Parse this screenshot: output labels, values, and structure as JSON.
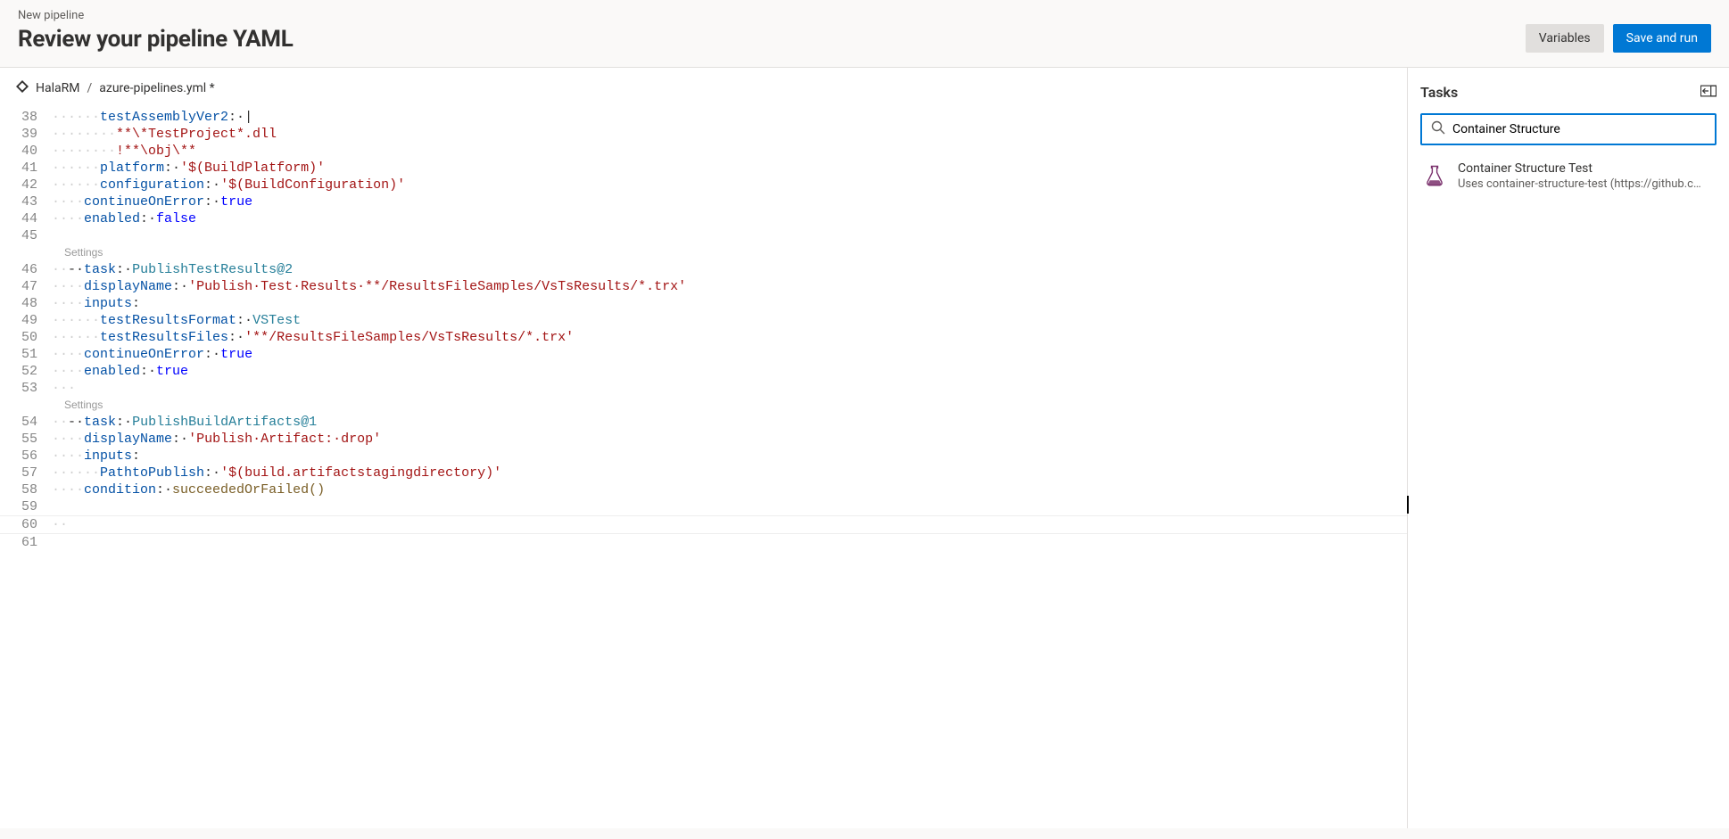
{
  "header": {
    "breadcrumb": "New pipeline",
    "title": "Review your pipeline YAML",
    "variables_label": "Variables",
    "save_run_label": "Save and run"
  },
  "file_bar": {
    "repo": "HalaRM",
    "sep": "/",
    "file": "azure-pipelines.yml *"
  },
  "codelens": {
    "settings": "Settings"
  },
  "code_lines": [
    {
      "n": 38,
      "tokens": [
        {
          "t": "ws",
          "v": "······"
        },
        {
          "t": "key",
          "v": "testAssemblyVer2"
        },
        {
          "t": "plain",
          "v": ":·"
        },
        {
          "t": "plain",
          "v": "|"
        }
      ]
    },
    {
      "n": 39,
      "tokens": [
        {
          "t": "ws",
          "v": "········"
        },
        {
          "t": "str",
          "v": "**\\*TestProject*.dll"
        }
      ]
    },
    {
      "n": 40,
      "tokens": [
        {
          "t": "ws",
          "v": "········"
        },
        {
          "t": "str",
          "v": "!**\\obj\\**"
        }
      ]
    },
    {
      "n": 41,
      "tokens": [
        {
          "t": "ws",
          "v": "······"
        },
        {
          "t": "key",
          "v": "platform"
        },
        {
          "t": "plain",
          "v": ":·"
        },
        {
          "t": "str",
          "v": "'$(BuildPlatform)'"
        }
      ]
    },
    {
      "n": 42,
      "tokens": [
        {
          "t": "ws",
          "v": "······"
        },
        {
          "t": "key",
          "v": "configuration"
        },
        {
          "t": "plain",
          "v": ":·"
        },
        {
          "t": "str",
          "v": "'$(BuildConfiguration)'"
        }
      ]
    },
    {
      "n": 43,
      "tokens": [
        {
          "t": "ws",
          "v": "····"
        },
        {
          "t": "key",
          "v": "continueOnError"
        },
        {
          "t": "plain",
          "v": ":·"
        },
        {
          "t": "bool",
          "v": "true"
        }
      ]
    },
    {
      "n": 44,
      "tokens": [
        {
          "t": "ws",
          "v": "····"
        },
        {
          "t": "key",
          "v": "enabled"
        },
        {
          "t": "plain",
          "v": ":·"
        },
        {
          "t": "bool",
          "v": "false"
        }
      ]
    },
    {
      "n": 45,
      "tokens": []
    },
    {
      "codelens": "settings"
    },
    {
      "n": 46,
      "tokens": [
        {
          "t": "ws",
          "v": "··"
        },
        {
          "t": "plain",
          "v": "-·"
        },
        {
          "t": "key",
          "v": "task"
        },
        {
          "t": "plain",
          "v": ":·"
        },
        {
          "t": "type",
          "v": "PublishTestResults@2"
        }
      ]
    },
    {
      "n": 47,
      "tokens": [
        {
          "t": "ws",
          "v": "····"
        },
        {
          "t": "key",
          "v": "displayName"
        },
        {
          "t": "plain",
          "v": ":·"
        },
        {
          "t": "str",
          "v": "'Publish·Test·Results·**/ResultsFileSamples/VsTsResults/*.trx'"
        }
      ]
    },
    {
      "n": 48,
      "tokens": [
        {
          "t": "ws",
          "v": "····"
        },
        {
          "t": "key",
          "v": "inputs"
        },
        {
          "t": "plain",
          "v": ":"
        }
      ]
    },
    {
      "n": 49,
      "tokens": [
        {
          "t": "ws",
          "v": "······"
        },
        {
          "t": "key",
          "v": "testResultsFormat"
        },
        {
          "t": "plain",
          "v": ":·"
        },
        {
          "t": "type",
          "v": "VSTest"
        }
      ]
    },
    {
      "n": 50,
      "tokens": [
        {
          "t": "ws",
          "v": "······"
        },
        {
          "t": "key",
          "v": "testResultsFiles"
        },
        {
          "t": "plain",
          "v": ":·"
        },
        {
          "t": "str",
          "v": "'**/ResultsFileSamples/VsTsResults/*.trx'"
        }
      ]
    },
    {
      "n": 51,
      "tokens": [
        {
          "t": "ws",
          "v": "····"
        },
        {
          "t": "key",
          "v": "continueOnError"
        },
        {
          "t": "plain",
          "v": ":·"
        },
        {
          "t": "bool",
          "v": "true"
        }
      ]
    },
    {
      "n": 52,
      "tokens": [
        {
          "t": "ws",
          "v": "····"
        },
        {
          "t": "key",
          "v": "enabled"
        },
        {
          "t": "plain",
          "v": ":·"
        },
        {
          "t": "bool",
          "v": "true"
        }
      ]
    },
    {
      "n": 53,
      "tokens": [
        {
          "t": "ws",
          "v": "···"
        }
      ]
    },
    {
      "codelens": "settings"
    },
    {
      "n": 54,
      "tokens": [
        {
          "t": "ws",
          "v": "··"
        },
        {
          "t": "plain",
          "v": "-·"
        },
        {
          "t": "key",
          "v": "task"
        },
        {
          "t": "plain",
          "v": ":·"
        },
        {
          "t": "type",
          "v": "PublishBuildArtifacts@1"
        }
      ]
    },
    {
      "n": 55,
      "tokens": [
        {
          "t": "ws",
          "v": "····"
        },
        {
          "t": "key",
          "v": "displayName"
        },
        {
          "t": "plain",
          "v": ":·"
        },
        {
          "t": "str",
          "v": "'Publish·Artifact:·drop'"
        }
      ]
    },
    {
      "n": 56,
      "tokens": [
        {
          "t": "ws",
          "v": "····"
        },
        {
          "t": "key",
          "v": "inputs"
        },
        {
          "t": "plain",
          "v": ":"
        }
      ]
    },
    {
      "n": 57,
      "tokens": [
        {
          "t": "ws",
          "v": "······"
        },
        {
          "t": "key",
          "v": "PathtoPublish"
        },
        {
          "t": "plain",
          "v": ":·"
        },
        {
          "t": "str",
          "v": "'$(build.artifactstagingdirectory)'"
        }
      ]
    },
    {
      "n": 58,
      "tokens": [
        {
          "t": "ws",
          "v": "····"
        },
        {
          "t": "key",
          "v": "condition"
        },
        {
          "t": "plain",
          "v": ":·"
        },
        {
          "t": "call",
          "v": "succeededOrFailed()"
        }
      ]
    },
    {
      "n": 59,
      "tokens": []
    },
    {
      "n": 60,
      "current": true,
      "tokens": [
        {
          "t": "ws",
          "v": "··"
        }
      ]
    },
    {
      "n": 61,
      "tokens": []
    }
  ],
  "tasks_panel": {
    "heading": "Tasks",
    "search_value": "Container Structure",
    "results": [
      {
        "title": "Container Structure Test",
        "desc": "Uses container-structure-test (https://github.com…"
      }
    ]
  }
}
